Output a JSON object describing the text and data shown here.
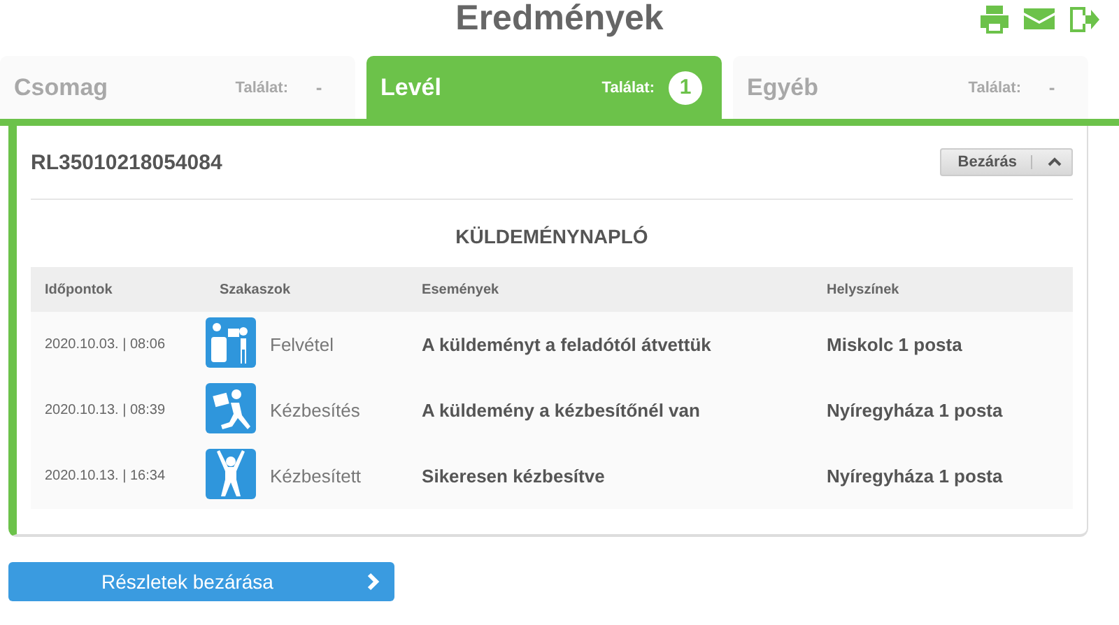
{
  "title": "Eredmények",
  "tabs": [
    {
      "label": "Csomag",
      "count_label": "Találat:",
      "count": "-",
      "selected": false
    },
    {
      "label": "Levél",
      "count_label": "Találat:",
      "count": "1",
      "selected": true
    },
    {
      "label": "Egyéb",
      "count_label": "Találat:",
      "count": "-",
      "selected": false
    }
  ],
  "item": {
    "tracking_number": "RL35010218054084",
    "close_button": "Bezárás",
    "expanded": true,
    "log_title": "KÜLDEMÉNYNAPLÓ",
    "columns": [
      "Időpontok",
      "Szakaszok",
      "Események",
      "Helyszínek"
    ],
    "rows": [
      {
        "time": "2020.10.03. | 08:06",
        "kind": "pickup",
        "stage": "Felvétel",
        "event": "A küldeményt a feladótól átvettük",
        "location": "Miskolc 1 posta"
      },
      {
        "time": "2020.10.13. | 08:39",
        "kind": "delivering",
        "stage": "Kézbesítés",
        "event": "A küldemény a kézbesítőnél van",
        "location": "Nyíregyháza 1 posta"
      },
      {
        "time": "2020.10.13. | 16:34",
        "kind": "delivered",
        "stage": "Kézbesített",
        "event": "Sikeresen kézbesítve",
        "location": "Nyíregyháza 1 posta"
      }
    ]
  },
  "details_button": "Részletek bezárása"
}
